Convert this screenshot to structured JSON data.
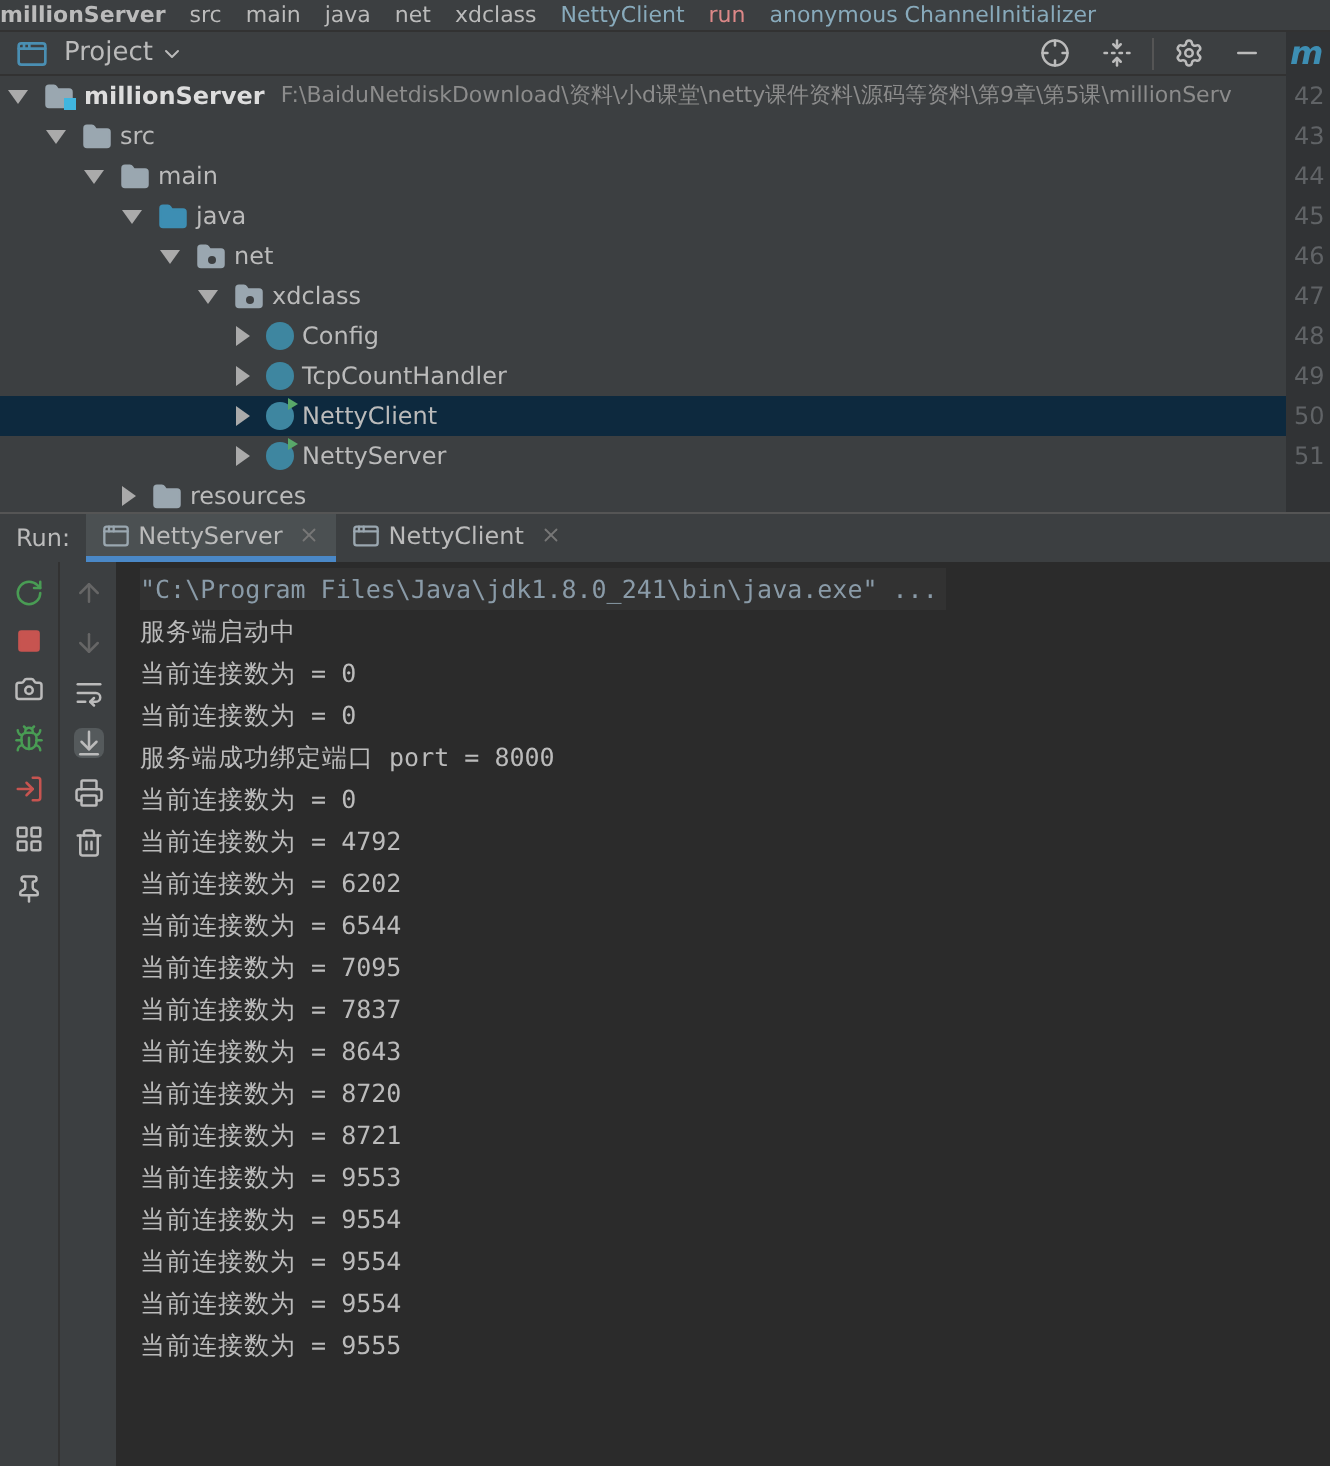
{
  "breadcrumb": [
    {
      "text": "millionServer",
      "kind": "module"
    },
    {
      "text": "src",
      "kind": "folder"
    },
    {
      "text": "main",
      "kind": "folder"
    },
    {
      "text": "java",
      "kind": "folder"
    },
    {
      "text": "net",
      "kind": "folder"
    },
    {
      "text": "xdclass",
      "kind": "folder"
    },
    {
      "text": "NettyClient",
      "kind": "class"
    },
    {
      "text": "run",
      "kind": "method"
    },
    {
      "text": "anonymous ChannelInitializer",
      "kind": "class"
    }
  ],
  "project_panel": {
    "title": "Project",
    "editor_tab_letter": "m"
  },
  "tree": [
    {
      "label": "millionServer",
      "path": "F:\\BaiduNetdiskDownload\\资料\\小d课堂\\netty课件资料\\源码等资料\\第9章\\第5课\\millionServ",
      "kind": "module",
      "expanded": true,
      "selected": false,
      "children": [
        {
          "label": "src",
          "kind": "folder",
          "expanded": true,
          "selected": false,
          "children": [
            {
              "label": "main",
              "kind": "folder",
              "expanded": true,
              "selected": false,
              "children": [
                {
                  "label": "java",
                  "kind": "source",
                  "expanded": true,
                  "selected": false,
                  "children": [
                    {
                      "label": "net",
                      "kind": "package",
                      "expanded": true,
                      "selected": false,
                      "children": [
                        {
                          "label": "xdclass",
                          "kind": "package",
                          "expanded": true,
                          "selected": false,
                          "children": [
                            {
                              "label": "Config",
                              "kind": "class",
                              "expanded": false,
                              "selected": false
                            },
                            {
                              "label": "TcpCountHandler",
                              "kind": "class",
                              "expanded": false,
                              "selected": false
                            },
                            {
                              "label": "NettyClient",
                              "kind": "runnable",
                              "expanded": false,
                              "selected": true
                            },
                            {
                              "label": "NettyServer",
                              "kind": "runnable",
                              "expanded": false,
                              "selected": false
                            }
                          ]
                        }
                      ]
                    }
                  ]
                },
                {
                  "label": "resources",
                  "kind": "resources",
                  "expanded": false,
                  "selected": false
                }
              ]
            }
          ]
        }
      ]
    }
  ],
  "line_numbers": [
    "42",
    "43",
    "44",
    "45",
    "46",
    "47",
    "48",
    "49",
    "50",
    "51"
  ],
  "run": {
    "label": "Run:",
    "tabs": [
      {
        "label": "NettyServer",
        "selected": true
      },
      {
        "label": "NettyClient",
        "selected": false
      }
    ],
    "console": [
      {
        "text": "\"C:\\Program Files\\Java\\jdk1.8.0_241\\bin\\java.exe\" ...",
        "kind": "command"
      },
      {
        "text": "服务端启动中",
        "kind": "output"
      },
      {
        "text": "当前连接数为 = 0",
        "kind": "output"
      },
      {
        "text": "当前连接数为 = 0",
        "kind": "output"
      },
      {
        "text": "服务端成功绑定端口 port = 8000",
        "kind": "output"
      },
      {
        "text": "当前连接数为 = 0",
        "kind": "output"
      },
      {
        "text": "当前连接数为 = 4792",
        "kind": "output"
      },
      {
        "text": "当前连接数为 = 6202",
        "kind": "output"
      },
      {
        "text": "当前连接数为 = 6544",
        "kind": "output"
      },
      {
        "text": "当前连接数为 = 7095",
        "kind": "output"
      },
      {
        "text": "当前连接数为 = 7837",
        "kind": "output"
      },
      {
        "text": "当前连接数为 = 8643",
        "kind": "output"
      },
      {
        "text": "当前连接数为 = 8720",
        "kind": "output"
      },
      {
        "text": "当前连接数为 = 8721",
        "kind": "output"
      },
      {
        "text": "当前连接数为 = 9553",
        "kind": "output"
      },
      {
        "text": "当前连接数为 = 9554",
        "kind": "output"
      },
      {
        "text": "当前连接数为 = 9554",
        "kind": "output"
      },
      {
        "text": "当前连接数为 = 9554",
        "kind": "output"
      },
      {
        "text": "当前连接数为 = 9555",
        "kind": "output"
      }
    ]
  }
}
